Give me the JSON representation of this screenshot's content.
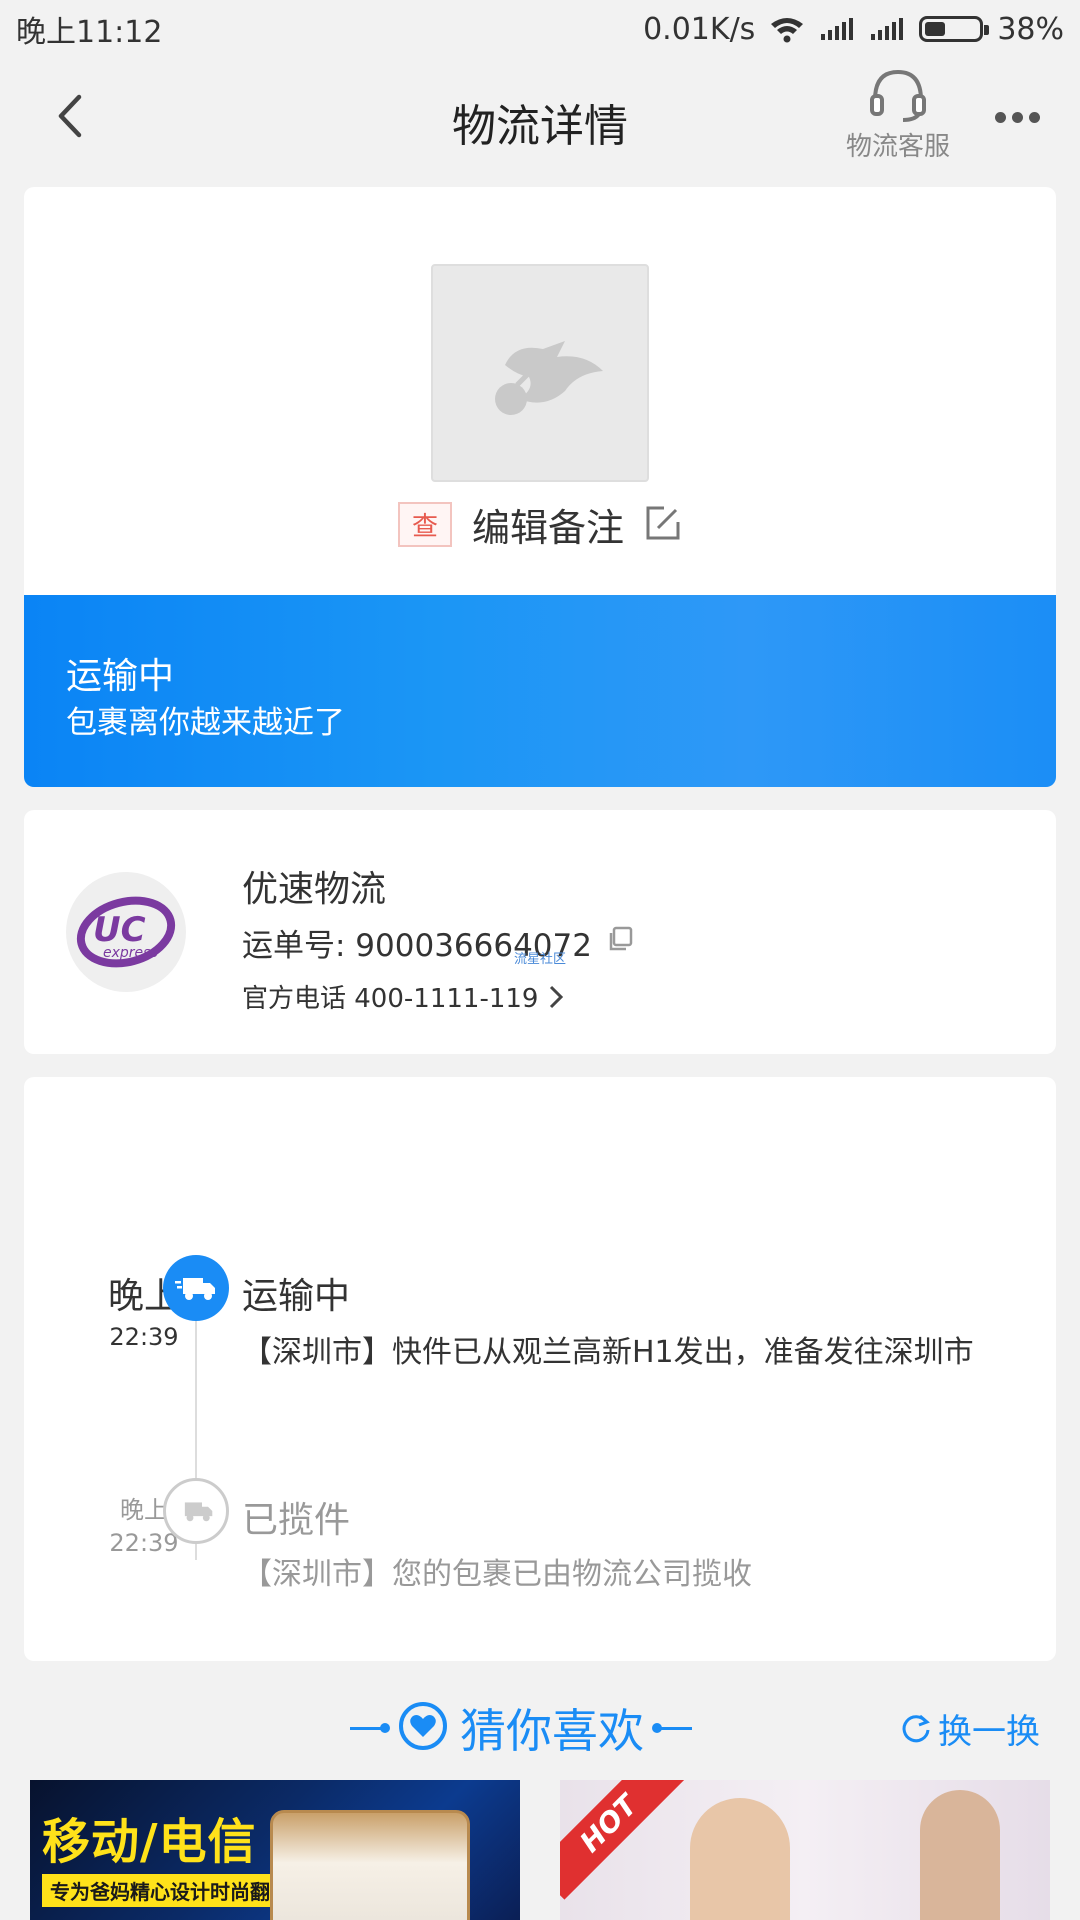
{
  "statusbar": {
    "time": "晚上11:12",
    "speed": "0.01K/s",
    "battery": "38%"
  },
  "header": {
    "title": "物流详情",
    "service_label": "物流客服"
  },
  "package": {
    "tag": "查",
    "remark_label": "编辑备注"
  },
  "status": {
    "title": "运输中",
    "subtitle": "包裹离你越来越近了"
  },
  "carrier": {
    "name": "优速物流",
    "logo_text": "UC",
    "logo_subtext": "express",
    "waybill_label": "运单号: 900036664072",
    "phone_label": "官方电话 400-1111-119",
    "watermark": "流星社区"
  },
  "timeline": [
    {
      "ampm": "晚上",
      "time": "22:39",
      "title": "运输中",
      "desc": "【深圳市】快件已从观兰高新H1发出，准备发往深圳市"
    },
    {
      "ampm": "晚上",
      "time": "22:39",
      "title": "已揽件",
      "desc": "【深圳市】您的包裹已由物流公司揽收"
    }
  ],
  "recommend": {
    "title": "猜你喜欢",
    "refresh": "换一换"
  },
  "products": [
    {
      "title": "移动/电信",
      "subtitle": "专为爸妈精心设计时尚翻盖"
    },
    {
      "badge": "HOT"
    }
  ],
  "colors": {
    "accent": "#1a8cf5",
    "status_banner": "#0a84f5",
    "tag_red": "#e75a4e",
    "promo_yellow": "#ffe21a"
  }
}
